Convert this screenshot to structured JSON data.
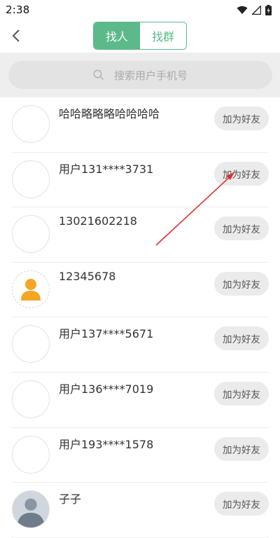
{
  "status_bar": {
    "time": "2:38"
  },
  "header": {
    "tabs": [
      {
        "label": "找人",
        "active": true
      },
      {
        "label": "找群",
        "active": false
      }
    ]
  },
  "search": {
    "placeholder": "搜索用户手机号"
  },
  "users": [
    {
      "name": "哈哈略略略哈哈哈哈",
      "button": "加为好友",
      "avatar": "blank"
    },
    {
      "name": "用户131****3731",
      "button": "加为好友",
      "avatar": "blank"
    },
    {
      "name": "13021602218",
      "button": "加为好友",
      "avatar": "blank"
    },
    {
      "name": "12345678",
      "button": "加为好友",
      "avatar": "person-icon"
    },
    {
      "name": "用户137****5671",
      "button": "加为好友",
      "avatar": "blank"
    },
    {
      "name": "用户136****7019",
      "button": "加为好友",
      "avatar": "blank"
    },
    {
      "name": "用户193****1578",
      "button": "加为好友",
      "avatar": "blank"
    },
    {
      "name": "子子",
      "button": "加为好友",
      "avatar": "photo"
    }
  ],
  "colors": {
    "accent": "#5cb98a",
    "annotation": "#e03030",
    "avatar_icon": "#f5a623"
  }
}
